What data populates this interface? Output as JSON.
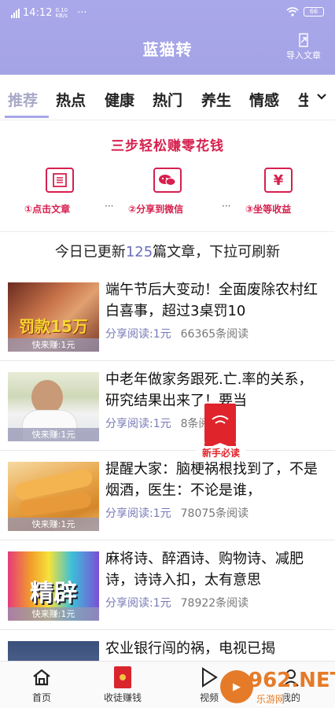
{
  "status_bar": {
    "time": "14:12",
    "net_speed": "0.10\nKB/s",
    "dots": "···",
    "battery": "66"
  },
  "header": {
    "title": "蓝猫转",
    "import_label": "导入文章"
  },
  "tabs": [
    "推荐",
    "热点",
    "健康",
    "热门",
    "养生",
    "情感",
    "生"
  ],
  "steps": {
    "title": "三步轻松赚零花钱",
    "items": [
      {
        "label": "①点击文章",
        "icon": "article-icon"
      },
      {
        "label": "②分享到微信",
        "icon": "wechat-icon"
      },
      {
        "label": "③坐等收益",
        "icon": "yen-icon"
      }
    ],
    "separator": "···"
  },
  "notice": {
    "prefix": "今日已更新",
    "count": "125",
    "suffix": "篇文章，下拉可刷新"
  },
  "articles": [
    {
      "title": "端午节后大变动！全面废除农村红白喜事，超过3桌罚10",
      "thumb_text": "罚款15万",
      "earn": "快来赚:1元",
      "share": "分享阅读:1元",
      "reads": "66365条阅读"
    },
    {
      "title": "中老年做家务跟死.亡.率的关系，研究结果出来了！要当",
      "thumb_text": "",
      "earn": "快来赚:1元",
      "share": "分享阅读:1元",
      "reads": "8条阅读"
    },
    {
      "title": "提醒大家：脑梗祸根找到了，不是烟酒，医生：不论是谁，",
      "thumb_text": "",
      "earn": "快来赚:1元",
      "share": "分享阅读:1元",
      "reads": "78075条阅读"
    },
    {
      "title": "麻将诗、醉酒诗、购物诗、减肥诗，诗诗入扣，太有意思",
      "thumb_text": "精辟",
      "earn": "快来赚:1元",
      "share": "分享阅读:1元",
      "reads": "78922条阅读"
    },
    {
      "title": "农业银行闯的祸，电视已揭",
      "thumb_text": "",
      "earn": "",
      "share": "",
      "reads": ""
    }
  ],
  "newbie_badge": "新手必读",
  "bottom_nav": [
    {
      "label": "首页",
      "icon": "home-icon"
    },
    {
      "label": "收徒赚钱",
      "icon": "redpacket-icon"
    },
    {
      "label": "视频",
      "icon": "play-icon"
    },
    {
      "label": "我的",
      "icon": "user-icon"
    }
  ],
  "watermark": {
    "brand": "962.NET",
    "sub": "乐游网"
  },
  "colors": {
    "header": "#a9a8ea",
    "accent_red": "#d6204e",
    "active_tab": "#a8a8c8",
    "share_blue": "#7779b8"
  }
}
